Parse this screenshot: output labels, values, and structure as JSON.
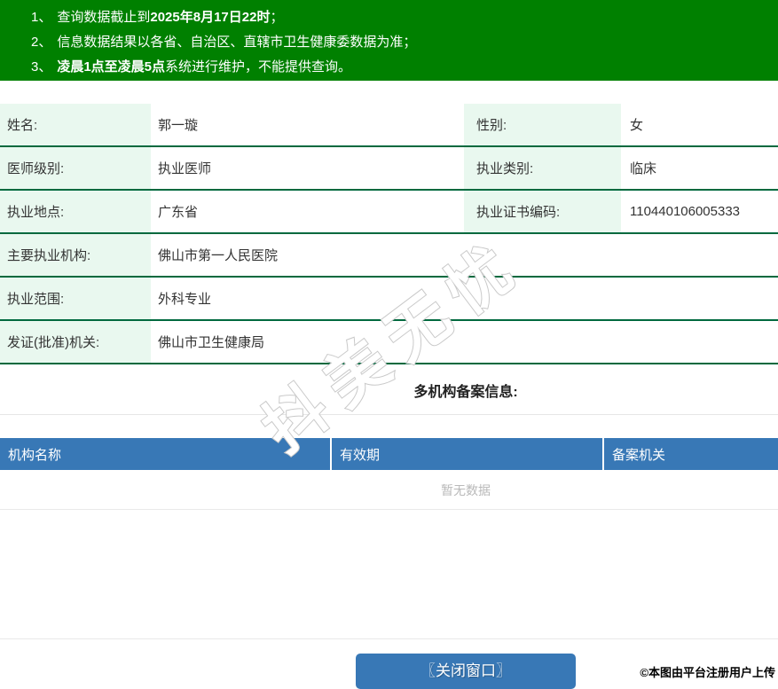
{
  "notice": {
    "items": [
      {
        "num": "1、",
        "pre": "查询数据截止到",
        "bold": "2025年8月17日22时",
        "post": "；"
      },
      {
        "num": "2、",
        "pre": "信息数据结果以各省、自治区、直辖市卫生健康委数据为准；",
        "bold": "",
        "post": ""
      },
      {
        "num": "3、",
        "pre": "",
        "bold": "凌晨1点至凌晨5点",
        "post": "系统进行维护，不能提供查询。"
      }
    ]
  },
  "profile": {
    "rows2col": [
      {
        "l1": "姓名:",
        "v1": "郭一璇",
        "l2": "性别:",
        "v2": "女"
      },
      {
        "l1": "医师级别:",
        "v1": "执业医师",
        "l2": "执业类别:",
        "v2": "临床"
      },
      {
        "l1": "执业地点:",
        "v1": "广东省",
        "l2": "执业证书编码:",
        "v2": "110440106005333"
      }
    ],
    "rows1col": [
      {
        "label": "主要执业机构:",
        "value": "佛山市第一人民医院"
      },
      {
        "label": "执业范围:",
        "value": "外科专业"
      },
      {
        "label": "发证(批准)机关:",
        "value": "佛山市卫生健康局"
      }
    ]
  },
  "filing": {
    "heading": "多机构备案信息:",
    "columns": [
      "机构名称",
      "有效期",
      "备案机关"
    ],
    "empty_text": "暂无数据"
  },
  "watermark": "抖美无忧",
  "footer": {
    "close_button": "〖关闭窗口〗",
    "copyright": "©本图由平台注册用户上传"
  },
  "colors": {
    "notice_bg": "#008000",
    "row_border": "#00693e",
    "label_bg": "#e9f8ef",
    "table_header_bg": "#3878b6",
    "button_bg": "#3878b6",
    "empty_text_color": "#b9b9b9"
  }
}
